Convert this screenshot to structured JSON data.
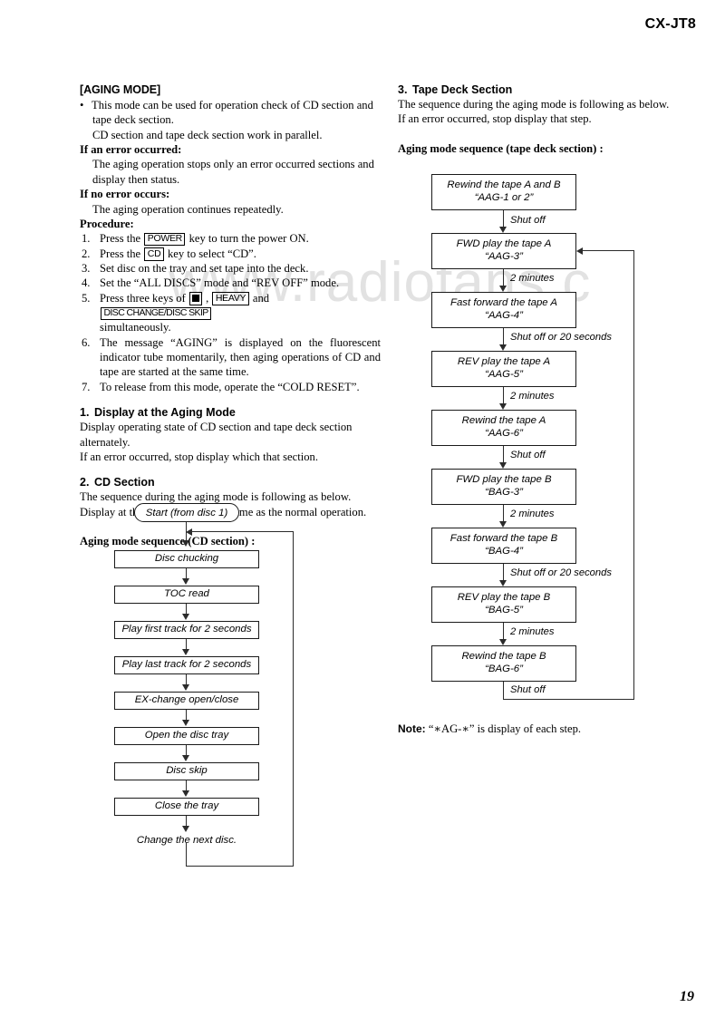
{
  "header": {
    "model": "CX-JT8"
  },
  "footer": {
    "page_number": "19"
  },
  "watermark": {
    "text": "www.radiofans.c"
  },
  "left_column": {
    "title": "[AGING MODE]",
    "bullet": {
      "marker": "•",
      "line1": "This mode can be used for operation check of CD section and",
      "line2": "tape deck section.",
      "line3": "CD section and tape deck section work in parallel."
    },
    "error_occurred": {
      "heading": "If an error occurred:",
      "line1": "The aging operation stops only an error occurred sections and",
      "line2": "display then status."
    },
    "no_error": {
      "heading": "If no error occurs:",
      "line1": "The aging operation continues repeatedly."
    },
    "procedure_heading": "Procedure:",
    "procedure": [
      {
        "index": "1.",
        "pre": "Press the ",
        "key": "POWER",
        "post": " key to turn the power ON."
      },
      {
        "index": "2.",
        "pre": "Press the ",
        "key": "CD",
        "post": " key to select “CD”."
      },
      {
        "index": "3.",
        "text": "Set disc on the tray and set tape into the deck."
      },
      {
        "index": "4.",
        "text": "Set the “ALL DISCS” mode and “REV OFF” mode."
      },
      {
        "index": "5.",
        "pre": "Press three keys of ",
        "key_square": "■",
        "mid1": " , ",
        "key2": "HEAVY",
        "mid2": " and ",
        "key3": "DISC CHANGE/DISC SKIP",
        "cont": "simultaneously."
      },
      {
        "index": "6.",
        "text": "The message “AGING” is displayed on the fluorescent indicator tube momentarily, then aging operations of CD and tape are started at the same time."
      },
      {
        "index": "7.",
        "text": "To release from this mode, operate the “COLD RESET”."
      }
    ],
    "section1": {
      "number": "1.",
      "title": "Display at the Aging Mode",
      "line1": "Display operating state of CD section and tape deck section",
      "line2": "alternately.",
      "line3": "If an error occurred, stop display which that section."
    },
    "section2": {
      "number": "2.",
      "title": "CD Section",
      "line1": "The sequence during the aging mode is following as below.",
      "line2": "Display at the aging mode is the same as the normal operation.",
      "seq_label": "Aging mode sequence (CD section) :"
    }
  },
  "right_column": {
    "section3": {
      "number": "3.",
      "title": "Tape Deck Section",
      "line1": "The sequence during the aging mode is following as below.",
      "line2": "If an error occurred, stop display that step.",
      "seq_label": "Aging mode sequence (tape deck section) :"
    },
    "note": {
      "label": "Note:",
      "text": "“∗AG-∗” is display of each step."
    }
  },
  "cd_flow": {
    "start": "Start (from disc 1)",
    "steps": [
      "Disc chucking",
      "TOC read",
      "Play first track for 2 seconds",
      "Play last track for 2 seconds",
      "EX-change open/close",
      "Open the disc tray",
      "Disc skip",
      "Close the tray"
    ],
    "tail": "Change the next disc."
  },
  "tape_flow": {
    "steps": [
      {
        "line1": "Rewind the tape A and B",
        "line2": "“AAG-1 or 2”"
      },
      {
        "line1": "FWD play the tape A",
        "line2": "“AAG-3”"
      },
      {
        "line1": "Fast forward the tape A",
        "line2": "“AAG-4”"
      },
      {
        "line1": "REV play the tape A",
        "line2": "“AAG-5”"
      },
      {
        "line1": "Rewind the tape A",
        "line2": "“AAG-6”"
      },
      {
        "line1": "FWD play the tape B",
        "line2": "“BAG-3”"
      },
      {
        "line1": "Fast forward the tape B",
        "line2": "“BAG-4”"
      },
      {
        "line1": "REV play the tape B",
        "line2": "“BAG-5”"
      },
      {
        "line1": "Rewind the tape B",
        "line2": "“BAG-6”"
      }
    ],
    "edge_labels": [
      "Shut off",
      "2 minutes",
      "Shut off or 20 seconds",
      "2 minutes",
      "Shut off",
      "2 minutes",
      "Shut off or 20 seconds",
      "2 minutes",
      "Shut off"
    ]
  }
}
